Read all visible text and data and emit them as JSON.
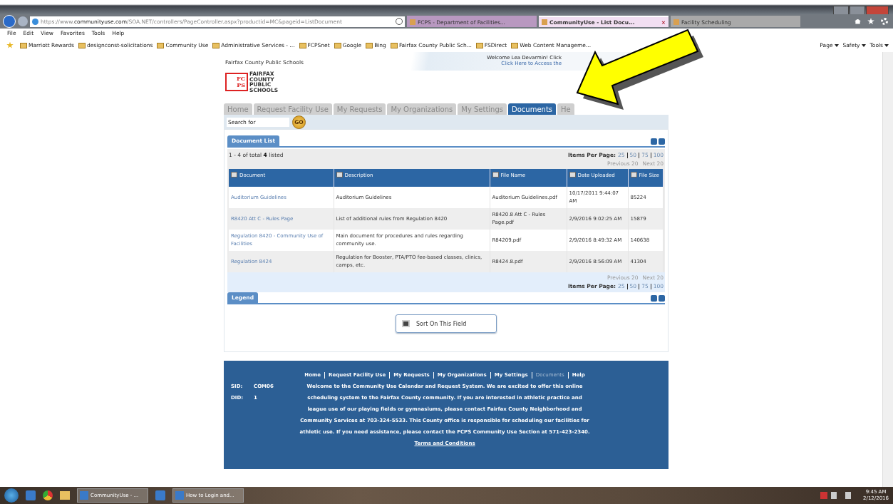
{
  "browser": {
    "url": "https://www.**communityuse.com**/SOA.NET/controllers/PageController.aspx?productid=MC&pageid=ListDocument",
    "tabs": [
      {
        "title": "FCPS - Department of Facilities...",
        "selected": false,
        "color": "#b898c0"
      },
      {
        "title": "CommunityUse - List Docu...",
        "selected": true,
        "color": "#f2dff2",
        "close": "×"
      },
      {
        "title": "Facility Scheduling",
        "selected": false,
        "color": "#a9a9a9"
      }
    ],
    "menu": [
      "File",
      "Edit",
      "View",
      "Favorites",
      "Tools",
      "Help"
    ],
    "favorites": [
      "Marriott Rewards",
      "designconst-solicitations",
      "Community Use",
      "Administrative Services - ...",
      "FCPSnet",
      "Google",
      "Bing",
      "Fairfax County Public Sch...",
      "FSDirect",
      "Web Content Manageme..."
    ],
    "commands": [
      "Page",
      "Safety",
      "Tools"
    ]
  },
  "page": {
    "org_name": "Fairfax County Public Schools",
    "welcome": "Welcome Lea Devarmin! Click",
    "access_link": "Click Here to Access the",
    "logo": {
      "letters_top": "FC",
      "letters_bottom": "PS",
      "words": [
        "FAIRFAX",
        "COUNTY",
        "PUBLIC",
        "SCHOOLS"
      ]
    },
    "nav": [
      {
        "label": "Home",
        "selected": false
      },
      {
        "label": "Request Facility Use",
        "selected": false
      },
      {
        "label": "My Requests",
        "selected": false
      },
      {
        "label": "My Organizations",
        "selected": false
      },
      {
        "label": "My Settings",
        "selected": false
      },
      {
        "label": "Documents",
        "selected": true
      },
      {
        "label": "He",
        "selected": false
      }
    ],
    "search": {
      "placeholder": "Search for",
      "button": "GO"
    },
    "document_list": {
      "title": "Document List",
      "summary": "1 - 4 of total **4** listed",
      "top": {
        "items_per_page_label": "Items Per Page:",
        "page_sizes": [
          "25",
          "50",
          "75",
          "100"
        ],
        "previous": "Previous 20",
        "next": "Next 20"
      },
      "columns": [
        "Document",
        "Description",
        "File Name",
        "Date Uploaded",
        "File Size"
      ],
      "rows": [
        [
          "Auditorium Guidelines",
          "Auditorium Guidelines",
          "Auditorium Guidelines.pdf",
          "10/17/2011 9:44:07 AM",
          "85224"
        ],
        [
          "R8420 Att C - Rules Page",
          "List of additional rules from Regulation 8420",
          "R8420.8 Att C - Rules Page.pdf",
          "2/9/2016 9:02:25 AM",
          "15879"
        ],
        [
          "Regulation 8420 - Community Use of Facilities",
          "Main document for procedures and rules regarding community use.",
          "R84209.pdf",
          "2/9/2016 8:49:32 AM",
          "140638"
        ],
        [
          "Regulation 8424",
          "Regulation for Booster, PTA/PTO fee-based classes, clinics, camps, etc.",
          "R8424.8.pdf",
          "2/9/2016 8:56:09 AM",
          "41304"
        ]
      ],
      "bottom": {
        "previous": "Previous 20",
        "next": "Next 20",
        "items_per_page_label": "Items Per Page:",
        "page_sizes": [
          "25",
          "50",
          "75",
          "100"
        ]
      }
    },
    "legend": {
      "title": "Legend",
      "item": "Sort On This Field"
    },
    "footer": {
      "links": [
        {
          "label": "Home",
          "selected": false
        },
        {
          "label": "Request Facility Use",
          "selected": false
        },
        {
          "label": "My Requests",
          "selected": false
        },
        {
          "label": "My Organizations",
          "selected": false
        },
        {
          "label": "My Settings",
          "selected": false
        },
        {
          "label": "Documents",
          "selected": true
        },
        {
          "label": "Help",
          "selected": false
        }
      ],
      "ids": [
        {
          "label": "SID:",
          "value": "COM06"
        },
        {
          "label": "DID:",
          "value": "1"
        }
      ],
      "message": "Welcome to the Community Use Calendar and Request System. We are excited to offer this online scheduling system to the Fairfax County community. If you are interested in athletic practice and league use of our playing fields or gymnasiums, please contact Fairfax County Neighborhood and Community Services at 703-324-5533. This County office is responsible for scheduling our facilities for athletic use. If you need assistance, please contact the FCPS Community Use Section at 571-423-2340.",
      "terms": "Terms and Conditions"
    }
  },
  "taskbar": {
    "items": [
      {
        "kind": "start"
      },
      {
        "kind": "app"
      },
      {
        "kind": "browser"
      },
      {
        "kind": "folder"
      },
      {
        "kind": "window",
        "label": "CommunityUse - ..."
      },
      {
        "kind": "app"
      },
      {
        "kind": "window",
        "label": "How to Login and..."
      }
    ],
    "time": "9:45 AM",
    "date": "2/12/2016"
  }
}
